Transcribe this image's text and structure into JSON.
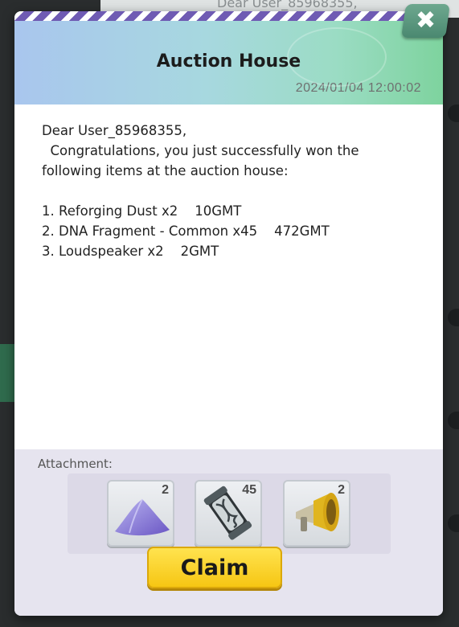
{
  "background": {
    "list_item_text": "Dear User_85968355,"
  },
  "modal": {
    "title": "Auction House",
    "date": "2024/01/04 12:00:02",
    "close_symbol": "✖",
    "message": {
      "greeting": "Dear User_85968355,",
      "intro_line1": "  Congratulations, you just successfully won the",
      "intro_line2": "following items at the auction house:",
      "items": [
        "1. Reforging Dust x2    10GMT",
        "2. DNA Fragment - Common x45    472GMT",
        "3. Loudspeaker x2    2GMT"
      ]
    },
    "attachment_label": "Attachment:",
    "attachments": [
      {
        "icon": "dust-pile-icon",
        "count": "2"
      },
      {
        "icon": "dna-capsule-icon",
        "count": "45"
      },
      {
        "icon": "loudspeaker-icon",
        "count": "2"
      }
    ],
    "claim_label": "Claim"
  },
  "colors": {
    "claim_button": "#f6c613",
    "close_button": "#5a9880",
    "stripe": "#6f5bb3"
  }
}
